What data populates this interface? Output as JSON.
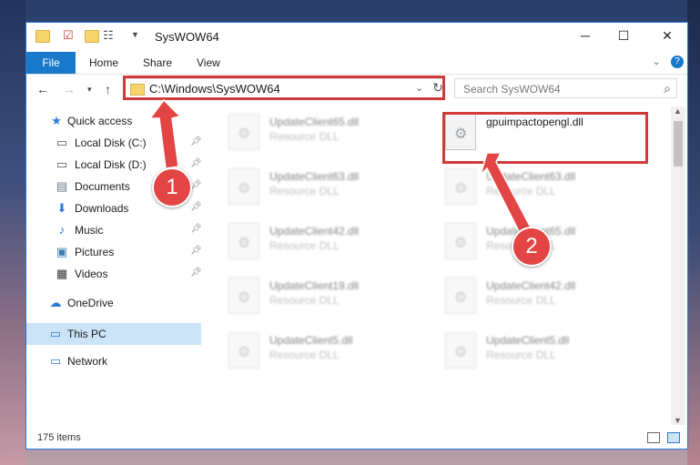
{
  "window": {
    "title": "SysWOW64"
  },
  "ribbon": {
    "file": "File",
    "tabs": [
      "Home",
      "Share",
      "View"
    ]
  },
  "address": {
    "path": "C:\\Windows\\SysWOW64"
  },
  "search": {
    "placeholder": "Search SysWOW64"
  },
  "sidebar": {
    "items": [
      {
        "label": "Quick access",
        "icon": "star-icon"
      },
      {
        "label": "Local Disk (C:)",
        "icon": "drive-icon"
      },
      {
        "label": "Local Disk (D:)",
        "icon": "drive-icon"
      },
      {
        "label": "Documents",
        "icon": "document-icon"
      },
      {
        "label": "Downloads",
        "icon": "download-icon"
      },
      {
        "label": "Music",
        "icon": "music-icon"
      },
      {
        "label": "Pictures",
        "icon": "pictures-icon"
      },
      {
        "label": "Videos",
        "icon": "videos-icon"
      },
      {
        "label": "OneDrive",
        "icon": "cloud-icon"
      },
      {
        "label": "This PC",
        "icon": "computer-icon"
      },
      {
        "label": "Network",
        "icon": "network-icon"
      }
    ]
  },
  "files": [
    {
      "name": "UpdateClient65.dll",
      "type": "Resource DLL"
    },
    {
      "name": "gpuimpactopengl.dll",
      "type": ""
    },
    {
      "name": "UpdateClient63.dll",
      "type": "Resource DLL"
    },
    {
      "name": "UpdateClient63.dll",
      "type": "Resource DLL"
    },
    {
      "name": "UpdateClient42.dll",
      "type": "Resource DLL"
    },
    {
      "name": "UpdateClient65.dll",
      "type": "Resource DLL"
    },
    {
      "name": "UpdateClient19.dll",
      "type": "Resource DLL"
    },
    {
      "name": "UpdateClient42.dll",
      "type": "Resource DLL"
    },
    {
      "name": "UpdateClient5.dll",
      "type": "Resource DLL"
    },
    {
      "name": "UpdateClient5.dll",
      "type": "Resource DLL"
    }
  ],
  "status": {
    "count": "175 items"
  },
  "annotations": [
    "1",
    "2"
  ],
  "colors": {
    "accent": "#1979ca",
    "highlight": "#d23a3a"
  }
}
